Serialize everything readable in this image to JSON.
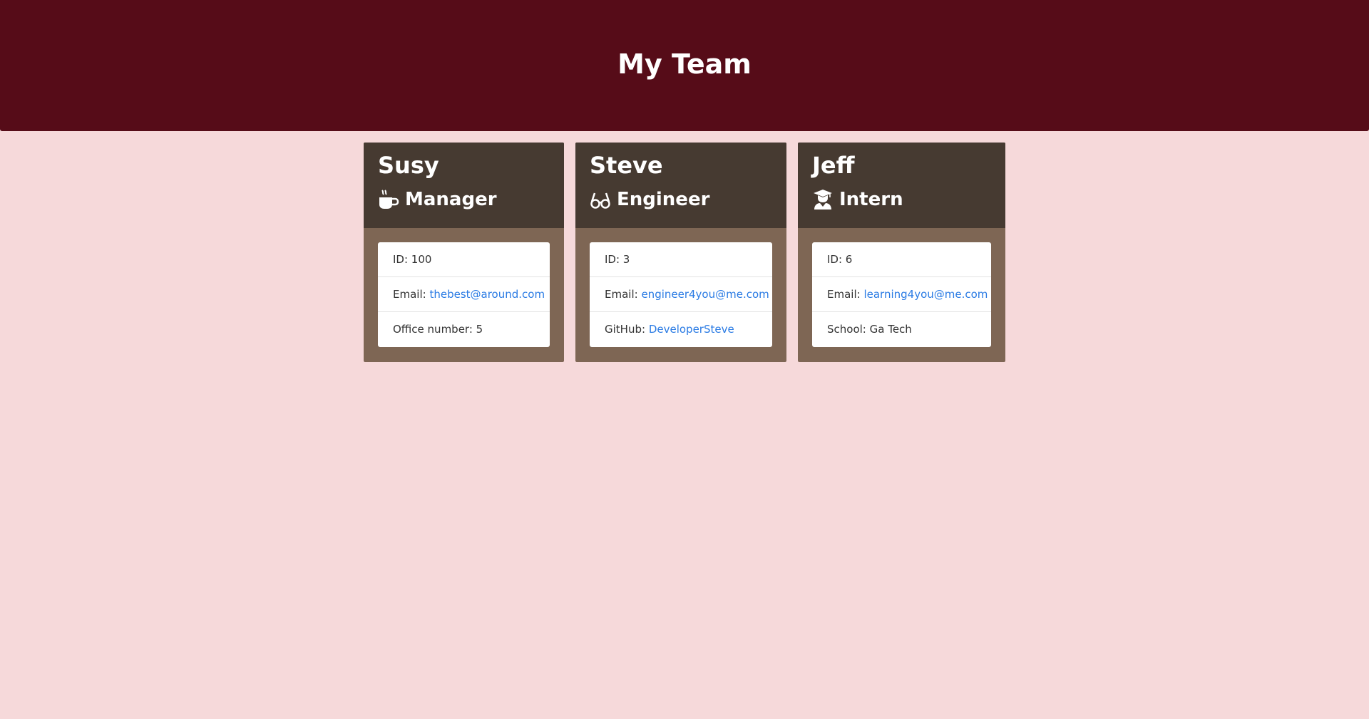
{
  "header": {
    "title": "My Team"
  },
  "colors": {
    "header_bg": "#560c18",
    "page_bg": "#f6d9da",
    "card_head_bg": "#463a31",
    "card_body_bg": "#7e6654",
    "link": "#2a7be4"
  },
  "team": [
    {
      "name": "Susy",
      "role": "Manager",
      "role_icon": "coffee-icon",
      "rows": [
        {
          "label": "ID: ",
          "value": "100"
        },
        {
          "label": "Email: ",
          "link": "thebest@around.com"
        },
        {
          "label": "Office number: ",
          "value": "5"
        }
      ]
    },
    {
      "name": "Steve",
      "role": "Engineer",
      "role_icon": "glasses-icon",
      "rows": [
        {
          "label": "ID: ",
          "value": "3"
        },
        {
          "label": "Email: ",
          "link": "engineer4you@me.com"
        },
        {
          "label": "GitHub: ",
          "link": "DeveloperSteve"
        }
      ]
    },
    {
      "name": "Jeff",
      "role": "Intern",
      "role_icon": "graduate-icon",
      "rows": [
        {
          "label": "ID: ",
          "value": "6"
        },
        {
          "label": "Email: ",
          "link": "learning4you@me.com"
        },
        {
          "label": "School: ",
          "value": "Ga Tech"
        }
      ]
    }
  ]
}
